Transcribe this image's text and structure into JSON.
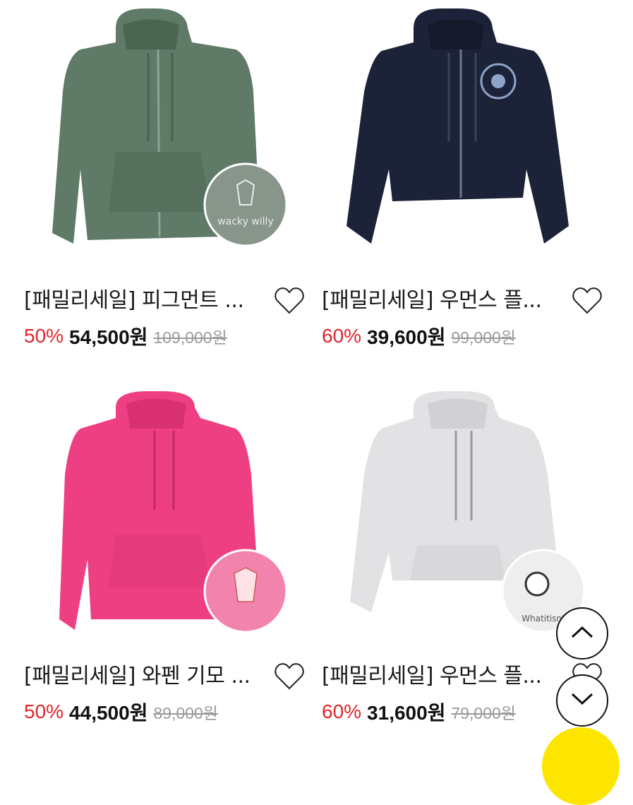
{
  "products": [
    {
      "title": "[패밀리세일] 피그먼트 ...",
      "discount": "50%",
      "sale_price": "54,500원",
      "original_price": "109,000원",
      "color": "#5f7a66",
      "detail": "wacky willy",
      "zip": true
    },
    {
      "title": "[패밀리세일] 우먼스 플...",
      "discount": "60%",
      "sale_price": "39,600원",
      "original_price": "99,000원",
      "color": "#1c2338",
      "detail": "",
      "zip": true
    },
    {
      "title": "[패밀리세일] 와펜 기모 ...",
      "discount": "50%",
      "sale_price": "44,500원",
      "original_price": "89,000원",
      "color": "#ef3f83",
      "detail": "",
      "zip": false
    },
    {
      "title": "[패밀리세일] 우먼스 플...",
      "discount": "60%",
      "sale_price": "31,600원",
      "original_price": "79,000원",
      "color": "#e2e2e4",
      "detail": "Whatitisnt",
      "zip": false
    }
  ],
  "icons": {
    "wishlist": "heart-outline-icon",
    "scroll_up": "chevron-up-icon",
    "scroll_down": "chevron-down-icon",
    "chat": "kakao-chat-button"
  },
  "colors": {
    "discount": "#e0262b",
    "sale_price": "#111111",
    "original_price": "#9a9a9a",
    "chat": "#fee500"
  }
}
